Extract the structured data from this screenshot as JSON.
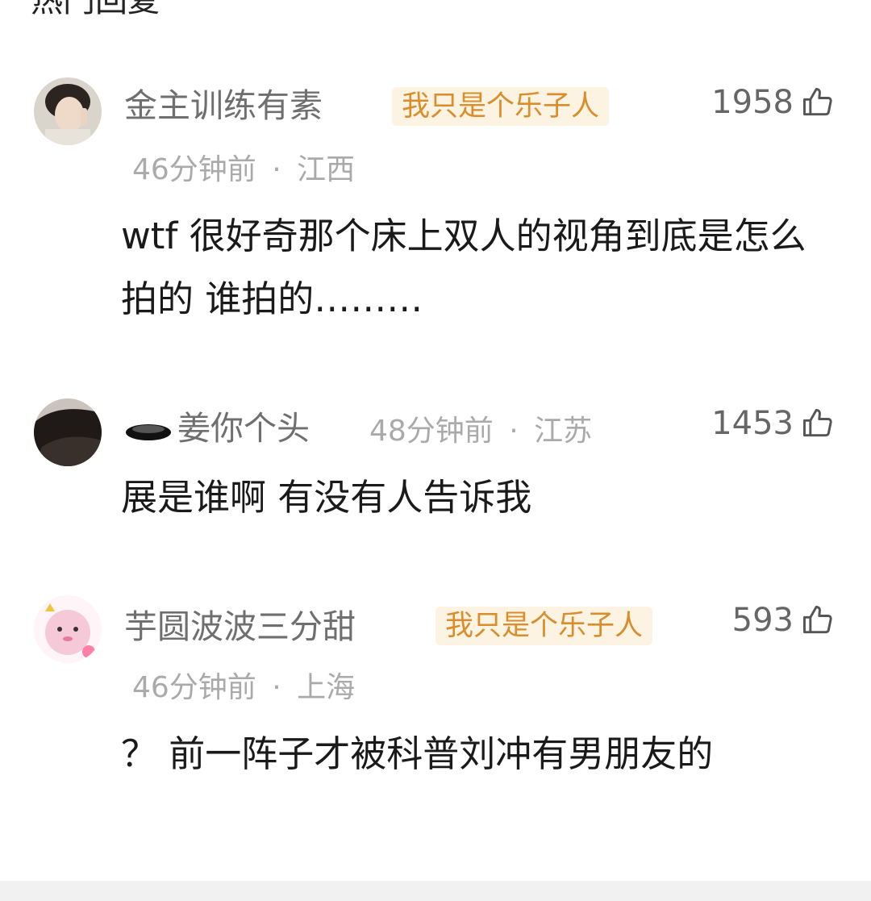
{
  "section_title": "热门回复",
  "comments": [
    {
      "username": "金主训练有素",
      "badge": "我只是个乐子人",
      "time": "46分钟前",
      "location": "江西",
      "likes": "1958",
      "text": "wtf 很好奇那个床上双人的视角到底是怎么拍的 谁拍的………"
    },
    {
      "username": "姜你个头",
      "time": "48分钟前",
      "location": "江苏",
      "likes": "1453",
      "text": "展是谁啊 有没有人告诉我"
    },
    {
      "username": "芋圆波波三分甜",
      "badge": "我只是个乐子人",
      "time": "46分钟前",
      "location": "上海",
      "likes": "593",
      "text": "？ 前一阵子才被科普刘冲有男朋友的"
    }
  ],
  "meta_separator": "·",
  "colors": {
    "badge_bg": "#fdf3e3",
    "badge_text": "#d98d2b",
    "username": "#6f6f6f",
    "meta": "#aaaaaa"
  }
}
